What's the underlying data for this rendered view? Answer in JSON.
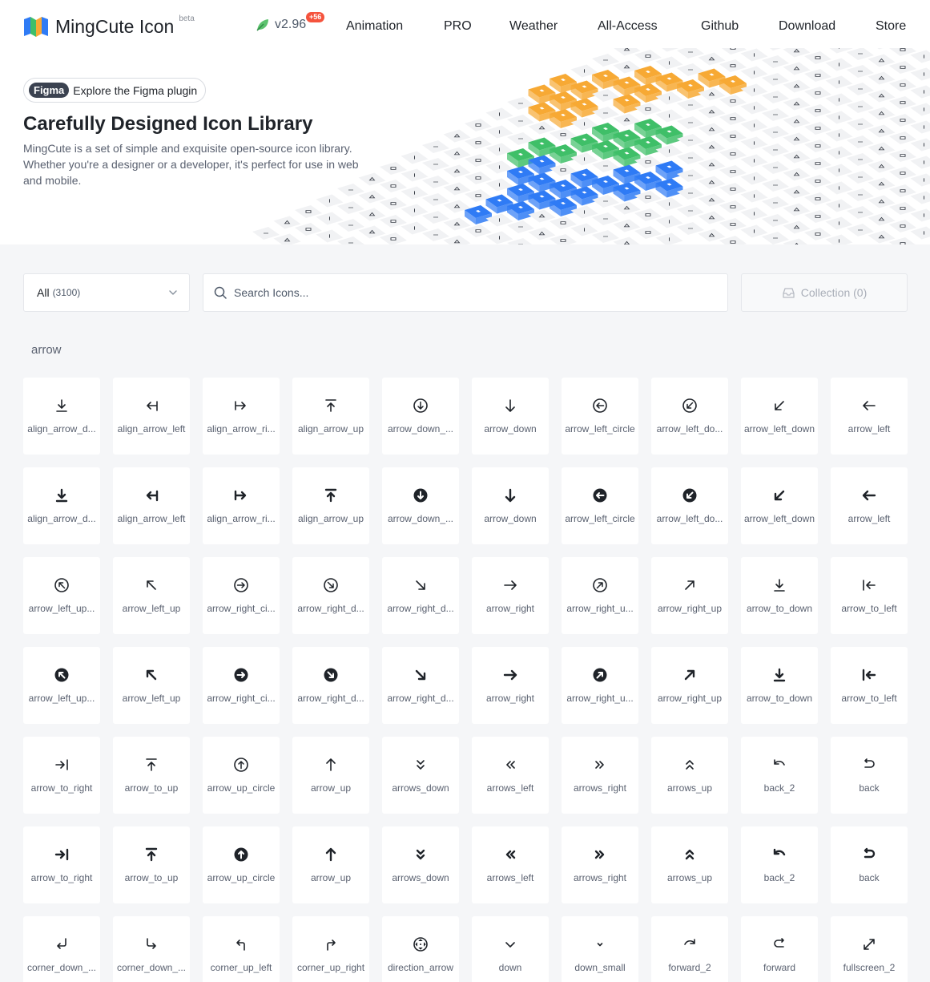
{
  "header": {
    "brand": "MingCute Icon",
    "beta": "beta",
    "version": "v2.96",
    "version_badge": "+56",
    "nav": [
      "Animation",
      "PRO",
      "Weather",
      "All-Access",
      "Github",
      "Download",
      "Store"
    ]
  },
  "hero": {
    "figma_tag": "Figma",
    "figma_text": "Explore the Figma plugin",
    "title": "Carefully Designed Icon Library",
    "description": "MingCute is a set of simple and exquisite open-source icon library. Whether you're a designer or a developer, it's perfect for use in web and mobile."
  },
  "toolbar": {
    "category": "All",
    "category_count": "(3100)",
    "search_placeholder": "Search Icons...",
    "search_value": "",
    "collection": "Collection (0)"
  },
  "section": {
    "title": "arrow"
  },
  "colors": {
    "blue": "#2f7bf5",
    "green": "#3fbf68",
    "orange": "#f7a934"
  },
  "icons": [
    {
      "label": "align_arrow_d...",
      "icon": "align-arrow-down",
      "filled": false
    },
    {
      "label": "align_arrow_left",
      "icon": "align-arrow-left",
      "filled": false
    },
    {
      "label": "align_arrow_ri...",
      "icon": "align-arrow-right",
      "filled": false
    },
    {
      "label": "align_arrow_up",
      "icon": "align-arrow-up",
      "filled": false
    },
    {
      "label": "arrow_down_...",
      "icon": "arrow-down-circle",
      "filled": false
    },
    {
      "label": "arrow_down",
      "icon": "arrow-down",
      "filled": false
    },
    {
      "label": "arrow_left_circle",
      "icon": "arrow-left-circle",
      "filled": false
    },
    {
      "label": "arrow_left_do...",
      "icon": "arrow-left-down-circle",
      "filled": false
    },
    {
      "label": "arrow_left_down",
      "icon": "arrow-left-down",
      "filled": false
    },
    {
      "label": "arrow_left",
      "icon": "arrow-left",
      "filled": false
    },
    {
      "label": "align_arrow_d...",
      "icon": "align-arrow-down",
      "filled": true
    },
    {
      "label": "align_arrow_left",
      "icon": "align-arrow-left",
      "filled": true
    },
    {
      "label": "align_arrow_ri...",
      "icon": "align-arrow-right",
      "filled": true
    },
    {
      "label": "align_arrow_up",
      "icon": "align-arrow-up",
      "filled": true
    },
    {
      "label": "arrow_down_...",
      "icon": "arrow-down-circle",
      "filled": true
    },
    {
      "label": "arrow_down",
      "icon": "arrow-down",
      "filled": true
    },
    {
      "label": "arrow_left_circle",
      "icon": "arrow-left-circle",
      "filled": true
    },
    {
      "label": "arrow_left_do...",
      "icon": "arrow-left-down-circle",
      "filled": true
    },
    {
      "label": "arrow_left_down",
      "icon": "arrow-left-down",
      "filled": true
    },
    {
      "label": "arrow_left",
      "icon": "arrow-left",
      "filled": true
    },
    {
      "label": "arrow_left_up...",
      "icon": "arrow-left-up-circle",
      "filled": false
    },
    {
      "label": "arrow_left_up",
      "icon": "arrow-left-up",
      "filled": false
    },
    {
      "label": "arrow_right_ci...",
      "icon": "arrow-right-circle",
      "filled": false
    },
    {
      "label": "arrow_right_d...",
      "icon": "arrow-right-down-circle",
      "filled": false
    },
    {
      "label": "arrow_right_d...",
      "icon": "arrow-right-down",
      "filled": false
    },
    {
      "label": "arrow_right",
      "icon": "arrow-right",
      "filled": false
    },
    {
      "label": "arrow_right_u...",
      "icon": "arrow-right-up-circle",
      "filled": false
    },
    {
      "label": "arrow_right_up",
      "icon": "arrow-right-up",
      "filled": false
    },
    {
      "label": "arrow_to_down",
      "icon": "arrow-to-down",
      "filled": false
    },
    {
      "label": "arrow_to_left",
      "icon": "arrow-to-left",
      "filled": false
    },
    {
      "label": "arrow_left_up...",
      "icon": "arrow-left-up-circle",
      "filled": true
    },
    {
      "label": "arrow_left_up",
      "icon": "arrow-left-up",
      "filled": true
    },
    {
      "label": "arrow_right_ci...",
      "icon": "arrow-right-circle",
      "filled": true
    },
    {
      "label": "arrow_right_d...",
      "icon": "arrow-right-down-circle",
      "filled": true
    },
    {
      "label": "arrow_right_d...",
      "icon": "arrow-right-down",
      "filled": true
    },
    {
      "label": "arrow_right",
      "icon": "arrow-right",
      "filled": true
    },
    {
      "label": "arrow_right_u...",
      "icon": "arrow-right-up-circle",
      "filled": true
    },
    {
      "label": "arrow_right_up",
      "icon": "arrow-right-up",
      "filled": true
    },
    {
      "label": "arrow_to_down",
      "icon": "arrow-to-down",
      "filled": true
    },
    {
      "label": "arrow_to_left",
      "icon": "arrow-to-left",
      "filled": true
    },
    {
      "label": "arrow_to_right",
      "icon": "arrow-to-right",
      "filled": false
    },
    {
      "label": "arrow_to_up",
      "icon": "arrow-to-up",
      "filled": false
    },
    {
      "label": "arrow_up_circle",
      "icon": "arrow-up-circle",
      "filled": false
    },
    {
      "label": "arrow_up",
      "icon": "arrow-up",
      "filled": false
    },
    {
      "label": "arrows_down",
      "icon": "arrows-down",
      "filled": false
    },
    {
      "label": "arrows_left",
      "icon": "arrows-left",
      "filled": false
    },
    {
      "label": "arrows_right",
      "icon": "arrows-right",
      "filled": false
    },
    {
      "label": "arrows_up",
      "icon": "arrows-up",
      "filled": false
    },
    {
      "label": "back_2",
      "icon": "back-2",
      "filled": false
    },
    {
      "label": "back",
      "icon": "back",
      "filled": false
    },
    {
      "label": "arrow_to_right",
      "icon": "arrow-to-right",
      "filled": true
    },
    {
      "label": "arrow_to_up",
      "icon": "arrow-to-up",
      "filled": true
    },
    {
      "label": "arrow_up_circle",
      "icon": "arrow-up-circle",
      "filled": true
    },
    {
      "label": "arrow_up",
      "icon": "arrow-up",
      "filled": true
    },
    {
      "label": "arrows_down",
      "icon": "arrows-down",
      "filled": true
    },
    {
      "label": "arrows_left",
      "icon": "arrows-left",
      "filled": true
    },
    {
      "label": "arrows_right",
      "icon": "arrows-right",
      "filled": true
    },
    {
      "label": "arrows_up",
      "icon": "arrows-up",
      "filled": true
    },
    {
      "label": "back_2",
      "icon": "back-2",
      "filled": true
    },
    {
      "label": "back",
      "icon": "back",
      "filled": true
    },
    {
      "label": "corner_down_...",
      "icon": "corner-down-left",
      "filled": false
    },
    {
      "label": "corner_down_...",
      "icon": "corner-down-right",
      "filled": false
    },
    {
      "label": "corner_up_left",
      "icon": "corner-up-left",
      "filled": false
    },
    {
      "label": "corner_up_right",
      "icon": "corner-up-right",
      "filled": false
    },
    {
      "label": "direction_arrow",
      "icon": "direction-arrow",
      "filled": false
    },
    {
      "label": "down",
      "icon": "down",
      "filled": false
    },
    {
      "label": "down_small",
      "icon": "down-small",
      "filled": false
    },
    {
      "label": "forward_2",
      "icon": "forward-2",
      "filled": false
    },
    {
      "label": "forward",
      "icon": "forward",
      "filled": false
    },
    {
      "label": "fullscreen_2",
      "icon": "fullscreen-2",
      "filled": false
    }
  ]
}
